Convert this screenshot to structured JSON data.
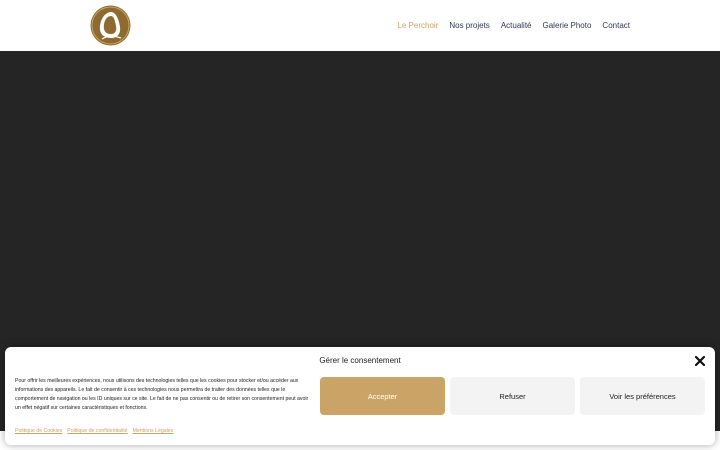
{
  "brand": {
    "logo_icon": "le-perchoir-logo",
    "accent": "#c9a466",
    "hero_background": "#252525"
  },
  "nav": {
    "items": [
      {
        "label": "Le Perchoir",
        "active": true
      },
      {
        "label": "Nos projets",
        "active": false
      },
      {
        "label": "Actualité",
        "active": false
      },
      {
        "label": "Galerie Photo",
        "active": false
      },
      {
        "label": "Contact",
        "active": false
      }
    ]
  },
  "consent": {
    "title": "Gérer le consentement",
    "close_icon": "close-icon",
    "body": "Pour offrir les meilleures expériences, nous utilisons des technologies telles que les cookies pour stocker et/ou accéder aux informations des appareils. Le fait de consentir à ces technologies nous permettra de traiter des données telles que le comportement de navigation ou les ID uniques sur ce site. Le fait de ne pas consentir ou de retirer son consentement peut avoir un effet négatif sur certaines caractéristiques et fonctions.",
    "accept_label": "Accepter",
    "refuse_label": "Refuser",
    "prefs_label": "Voir les préférences",
    "links": [
      "Politique de Cookies",
      "Politique de confidentialité",
      "Mentions Légales"
    ]
  }
}
